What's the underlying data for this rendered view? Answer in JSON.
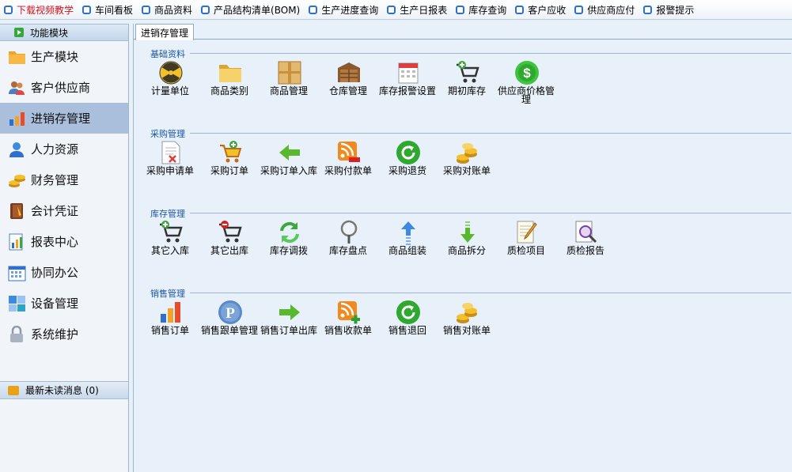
{
  "topbar": {
    "items": [
      {
        "label": "下载视频教学",
        "color": "#d0141d"
      },
      {
        "label": "车间看板"
      },
      {
        "label": "商品资料"
      },
      {
        "label": "产品结构清单(BOM)"
      },
      {
        "label": "生产进度查询"
      },
      {
        "label": "生产日报表"
      },
      {
        "label": "库存查询"
      },
      {
        "label": "客户应收"
      },
      {
        "label": "供应商应付"
      },
      {
        "label": "报警提示"
      }
    ]
  },
  "sidebar": {
    "header": "功能模块",
    "items": [
      {
        "label": "生产模块",
        "icon": "folder-icon"
      },
      {
        "label": "客户供应商",
        "icon": "people-icon"
      },
      {
        "label": "进销存管理",
        "icon": "bar-chart-icon",
        "active": true
      },
      {
        "label": "人力资源",
        "icon": "user-icon"
      },
      {
        "label": "财务管理",
        "icon": "coins-icon"
      },
      {
        "label": "会计凭证",
        "icon": "notebook-icon"
      },
      {
        "label": "报表中心",
        "icon": "report-icon"
      },
      {
        "label": "协同办公",
        "icon": "calendar-icon"
      },
      {
        "label": "设备管理",
        "icon": "device-icon"
      },
      {
        "label": "系统维护",
        "icon": "lock-icon"
      }
    ],
    "messages": "最新未读消息 (0)"
  },
  "main": {
    "tab": "进销存管理",
    "sections": [
      {
        "title": "基础资料",
        "items": [
          {
            "label": "计量单位",
            "icon": "radiation-icon"
          },
          {
            "label": "商品类别",
            "icon": "folder-icon"
          },
          {
            "label": "商品管理",
            "icon": "box-icon"
          },
          {
            "label": "仓库管理",
            "icon": "warehouse-icon"
          },
          {
            "label": "库存报警设置",
            "icon": "calendar-alert-icon"
          },
          {
            "label": "期初库存",
            "icon": "cart-add-icon"
          },
          {
            "label": "供应商价格管理",
            "icon": "dollar-icon"
          }
        ]
      },
      {
        "title": "采购管理",
        "items": [
          {
            "label": "采购申请单",
            "icon": "document-icon"
          },
          {
            "label": "采购订单",
            "icon": "cart-icon"
          },
          {
            "label": "采购订单入库",
            "icon": "arrow-left-icon"
          },
          {
            "label": "采购付款单",
            "icon": "rss-minus-icon"
          },
          {
            "label": "采购退货",
            "icon": "refresh-circle-icon"
          },
          {
            "label": "采购对账单",
            "icon": "coins-icon"
          }
        ]
      },
      {
        "title": "库存管理",
        "items": [
          {
            "label": "其它入库",
            "icon": "cart-add-icon"
          },
          {
            "label": "其它出库",
            "icon": "cart-remove-icon"
          },
          {
            "label": "库存调拨",
            "icon": "sync-icon"
          },
          {
            "label": "库存盘点",
            "icon": "magnifier-icon"
          },
          {
            "label": "商品组装",
            "icon": "arrow-up-icon"
          },
          {
            "label": "商品拆分",
            "icon": "arrow-down-icon"
          },
          {
            "label": "质检项目",
            "icon": "note-pencil-icon"
          },
          {
            "label": "质检报告",
            "icon": "report-search-icon"
          }
        ]
      },
      {
        "title": "销售管理",
        "items": [
          {
            "label": "销售订单",
            "icon": "bar-chart-icon"
          },
          {
            "label": "销售跟单管理",
            "icon": "p-circle-icon"
          },
          {
            "label": "销售订单出库",
            "icon": "arrow-right-icon"
          },
          {
            "label": "销售收款单",
            "icon": "rss-plus-icon"
          },
          {
            "label": "销售退回",
            "icon": "refresh-circle-icon"
          },
          {
            "label": "销售对账单",
            "icon": "coins-icon"
          }
        ]
      }
    ]
  }
}
